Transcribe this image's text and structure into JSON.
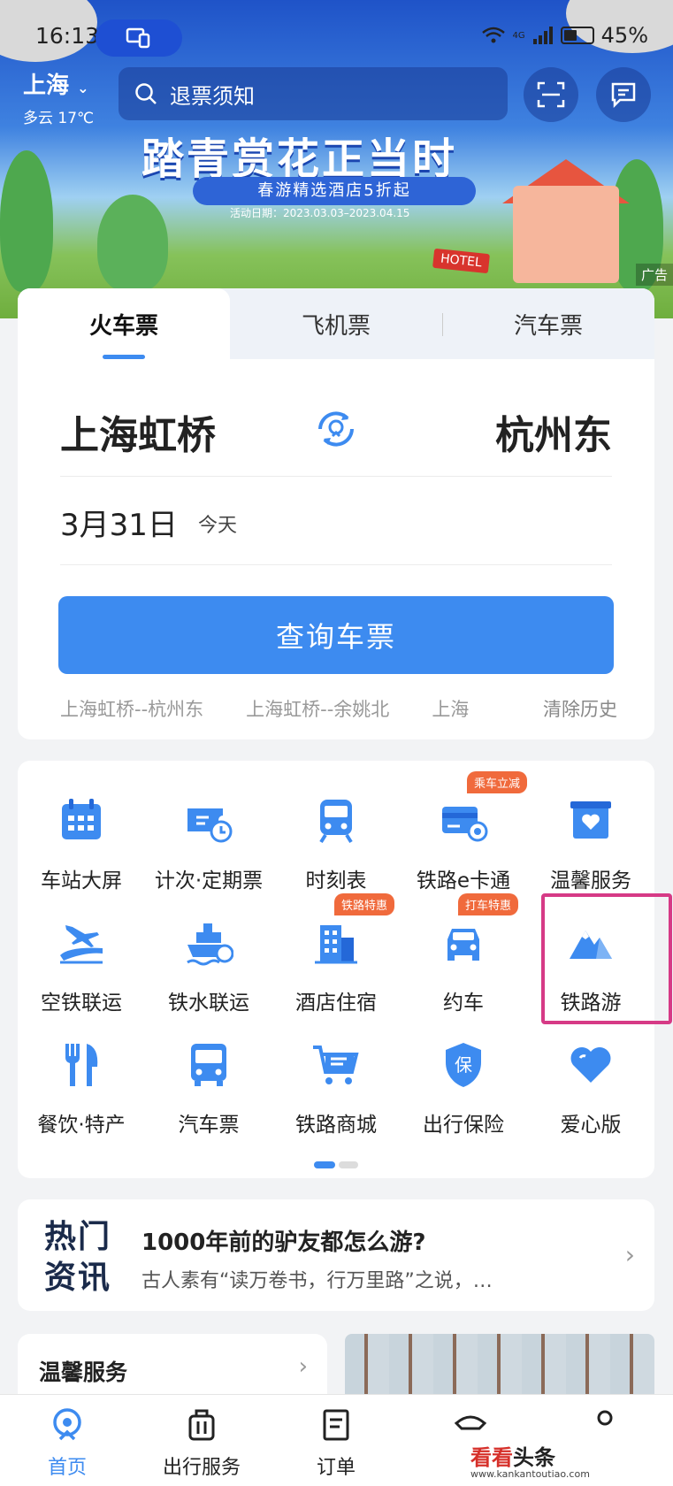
{
  "status_bar": {
    "time": "16:13",
    "battery": "45%",
    "network": "4G"
  },
  "location": {
    "city": "上海",
    "weather": "多云 17℃"
  },
  "search": {
    "placeholder": "退票须知"
  },
  "banner": {
    "title": "踏青赏花正当时",
    "subtitle": "春游精选酒店5折起",
    "date": "活动日期：2023.03.03–2023.04.15",
    "sign": "HOTEL",
    "ad_label": "广告"
  },
  "ticket_tabs": [
    {
      "label": "火车票"
    },
    {
      "label": "飞机票"
    },
    {
      "label": "汽车票"
    }
  ],
  "ticket": {
    "from": "上海虹桥",
    "to": "杭州东",
    "date": "3月31日",
    "day": "今天",
    "query_label": "查询车票",
    "history": [
      "上海虹桥--杭州东",
      "上海虹桥--余姚北",
      "上海"
    ],
    "clear_label": "清除历史"
  },
  "services": [
    {
      "label": "车站大屏",
      "icon": "calendar-icon"
    },
    {
      "label": "计次·定期票",
      "icon": "ticket-clock-icon"
    },
    {
      "label": "时刻表",
      "icon": "train-icon"
    },
    {
      "label": "铁路e卡通",
      "icon": "card-icon",
      "tag": "乘车立减"
    },
    {
      "label": "温馨服务",
      "icon": "heart-box-icon"
    },
    {
      "label": "空铁联运",
      "icon": "plane-train-icon"
    },
    {
      "label": "铁水联运",
      "icon": "ship-icon"
    },
    {
      "label": "酒店住宿",
      "icon": "hotel-icon",
      "tag": "铁路特惠"
    },
    {
      "label": "约车",
      "icon": "car-icon",
      "tag": "打车特惠"
    },
    {
      "label": "铁路游",
      "icon": "mountain-icon"
    },
    {
      "label": "餐饮·特产",
      "icon": "fork-knife-icon"
    },
    {
      "label": "汽车票",
      "icon": "bus-icon"
    },
    {
      "label": "铁路商城",
      "icon": "cart-icon"
    },
    {
      "label": "出行保险",
      "icon": "shield-icon"
    },
    {
      "label": "爱心版",
      "icon": "heart-icon"
    }
  ],
  "news": {
    "badge_line1": "热门",
    "badge_line2": "资讯",
    "title": "1000年前的驴友都怎么游?",
    "body": "古人素有“读万卷书，行万里路”之说，…"
  },
  "warm_service": {
    "title": "温馨服务"
  },
  "bottom_nav": [
    {
      "label": "首页",
      "icon": "home-icon",
      "active": true
    },
    {
      "label": "出行服务",
      "icon": "luggage-icon"
    },
    {
      "label": "订单",
      "icon": "order-icon"
    },
    {
      "label": "",
      "icon": "hat-icon"
    },
    {
      "label": "",
      "icon": "person-icon"
    }
  ],
  "watermark": {
    "brand_red": "看看",
    "brand_black": "头条",
    "url": "www.kankantoutiao.com"
  },
  "colors": {
    "accent": "#3d8bf0",
    "tag": "#f06a3c",
    "highlight": "#d63a86"
  }
}
